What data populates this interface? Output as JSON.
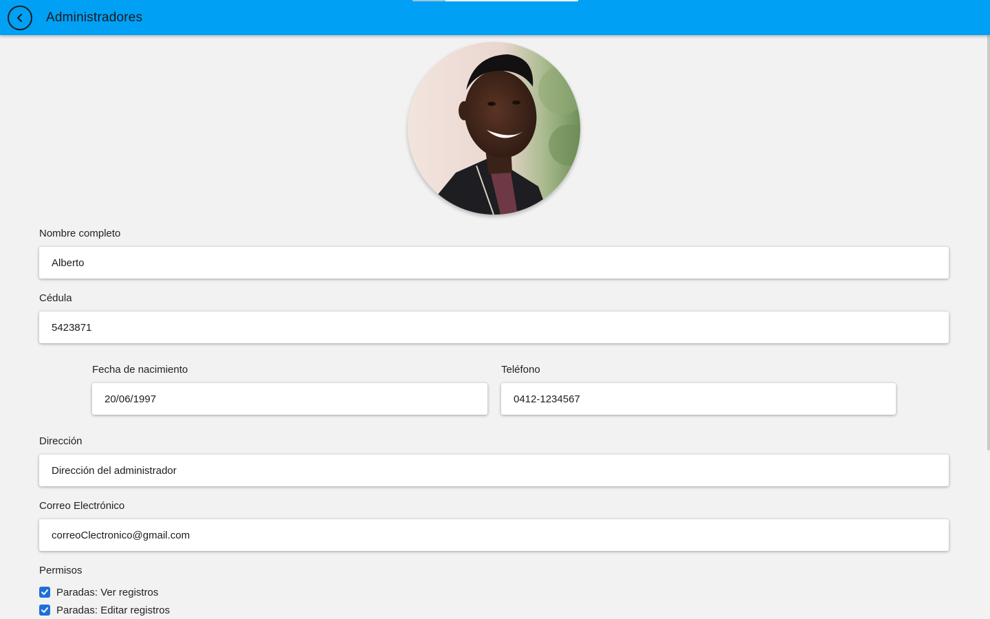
{
  "header": {
    "title": "Administradores",
    "back_icon": "chevron-left-circle-icon",
    "color": "#00a0f5"
  },
  "profile": {
    "avatar": "user-portrait-photo"
  },
  "form": {
    "nombre": {
      "label": "Nombre completo",
      "value": "Alberto"
    },
    "cedula": {
      "label": "Cédula",
      "value": "5423871"
    },
    "fecha_nacimiento": {
      "label": "Fecha de nacimiento",
      "value": "20/06/1997"
    },
    "telefono": {
      "label": "Teléfono",
      "value": "0412-1234567"
    },
    "direccion": {
      "label": "Dirección",
      "value": "Dirección del administrador"
    },
    "correo": {
      "label": "Correo Electrónico",
      "value": "correoClectronico@gmail.com"
    }
  },
  "permisos": {
    "label": "Permisos",
    "items": [
      {
        "label": "Paradas: Ver registros",
        "checked": true
      },
      {
        "label": "Paradas: Editar registros",
        "checked": true
      }
    ],
    "accent": "#1e6fd9"
  }
}
